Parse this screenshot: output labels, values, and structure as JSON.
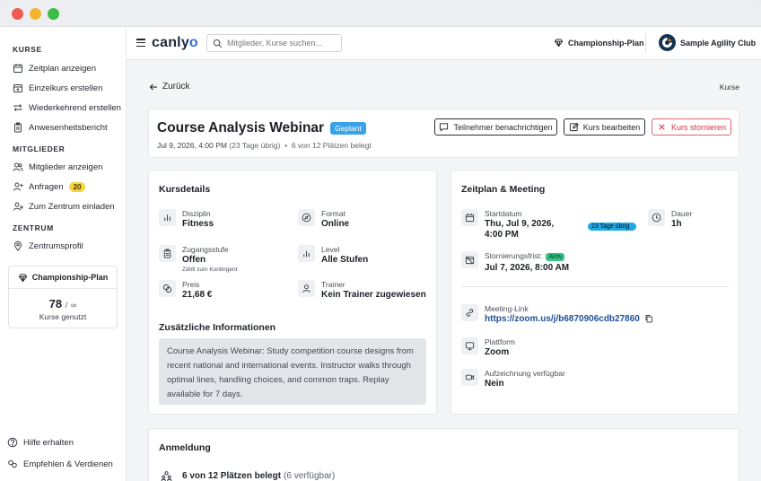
{
  "sidebar": {
    "sections": [
      {
        "title": "KURSE"
      },
      {
        "title": "MITGLIEDER"
      },
      {
        "title": "ZENTRUM"
      }
    ],
    "items": [
      {
        "label": "Zeitplan anzeigen",
        "icon": "calendar-icon"
      },
      {
        "label": "Einzelkurs erstellen",
        "icon": "calendar-plus-icon"
      },
      {
        "label": "Wiederkehrend erstellen",
        "icon": "repeat-icon"
      },
      {
        "label": "Anwesenheitsbericht",
        "icon": "clipboard-icon"
      },
      {
        "label": "Mitglieder anzeigen",
        "icon": "users-icon"
      },
      {
        "label": "Anfragen",
        "icon": "user-plus-icon",
        "badge": "20"
      },
      {
        "label": "Zum Zentrum einladen",
        "icon": "user-add-icon"
      },
      {
        "label": "Zentrumsprofil",
        "icon": "location-pin-icon"
      }
    ],
    "plan": {
      "title": "Championship-Plan",
      "count": "78",
      "limit": "∞",
      "separator": "/",
      "label": "Kurse genutzt"
    },
    "footer": [
      {
        "label": "Hilfe erhalten",
        "icon": "help-icon"
      },
      {
        "label": "Empfehlen & Verdienen",
        "icon": "gift-icon"
      }
    ]
  },
  "topbar": {
    "logo_prefix": "canly",
    "logo_suffix": "o",
    "search_placeholder": "Mitglieder, Kurse suchen...",
    "plan_label": "Championship-Plan",
    "club_name": "Sample Agility Club"
  },
  "nav": {
    "back_label": "Zurück",
    "breadcrumb": "Kurse"
  },
  "course": {
    "title": "Course Analysis Webinar",
    "status": "Geplant",
    "date": "Jul 9, 2026, 4:00 PM",
    "days_left": "(23 Tage übrig)",
    "bullet": "•",
    "occupancy": "6 von 12 Plätzen belegt",
    "actions": {
      "notify": "Teilnehmer benachrichtigen",
      "edit": "Kurs bearbeiten",
      "cancel": "Kurs stornieren"
    }
  },
  "details": {
    "title": "Kursdetails",
    "fields": [
      {
        "label": "Disziplin",
        "value": "Fitness",
        "icon": "chart-bars-icon"
      },
      {
        "label": "Format",
        "value": "Online",
        "icon": "compass-icon"
      },
      {
        "label": "Zugangsstufe",
        "value": "Offen",
        "note": "Zählt zum Kontingent",
        "icon": "clipboard-icon"
      },
      {
        "label": "Level",
        "value": "Alle Stufen",
        "icon": "level-bars-icon"
      },
      {
        "label": "Preis",
        "value": "21,68 €",
        "icon": "coins-icon"
      },
      {
        "label": "Trainer",
        "value": "Kein Trainer zugewiesen",
        "icon": "user-icon"
      }
    ],
    "extra_title": "Zusätzliche Informationen",
    "extra_text": "Course Analysis Webinar: Study competition course designs from recent national and international events. Instructor walks through optimal lines, handling choices, and common traps. Replay available for 7 days."
  },
  "schedule": {
    "title": "Zeitplan & Meeting",
    "start_label": "Startdatum",
    "start_value": "Thu, Jul 9, 2026, 4:00 PM",
    "start_chip": "23 Tage übrig",
    "duration_label": "Dauer",
    "duration_value": "1h",
    "deadline_label": "Stornierungsfrist:",
    "deadline_badge": "Aktiv",
    "deadline_value": "Jul 7, 2026, 8:00 AM",
    "meeting_label": "Meeting-Link",
    "meeting_url": "https://zoom.us/j/b6870906cdb27860",
    "platform_label": "Plattform",
    "platform_value": "Zoom",
    "recording_label": "Aufzeichnung verfügbar",
    "recording_value": "Nein"
  },
  "registration": {
    "title": "Anmeldung",
    "summary": "6 von 12 Plätzen belegt",
    "available": "(6 verfügbar)"
  },
  "colors": {
    "status_blue": "#3aa3e8",
    "cancel_red": "#d9343e",
    "badge_yellow": "#f5d33f",
    "aktiv_green": "#37c486",
    "link_blue": "#1f4f99"
  }
}
